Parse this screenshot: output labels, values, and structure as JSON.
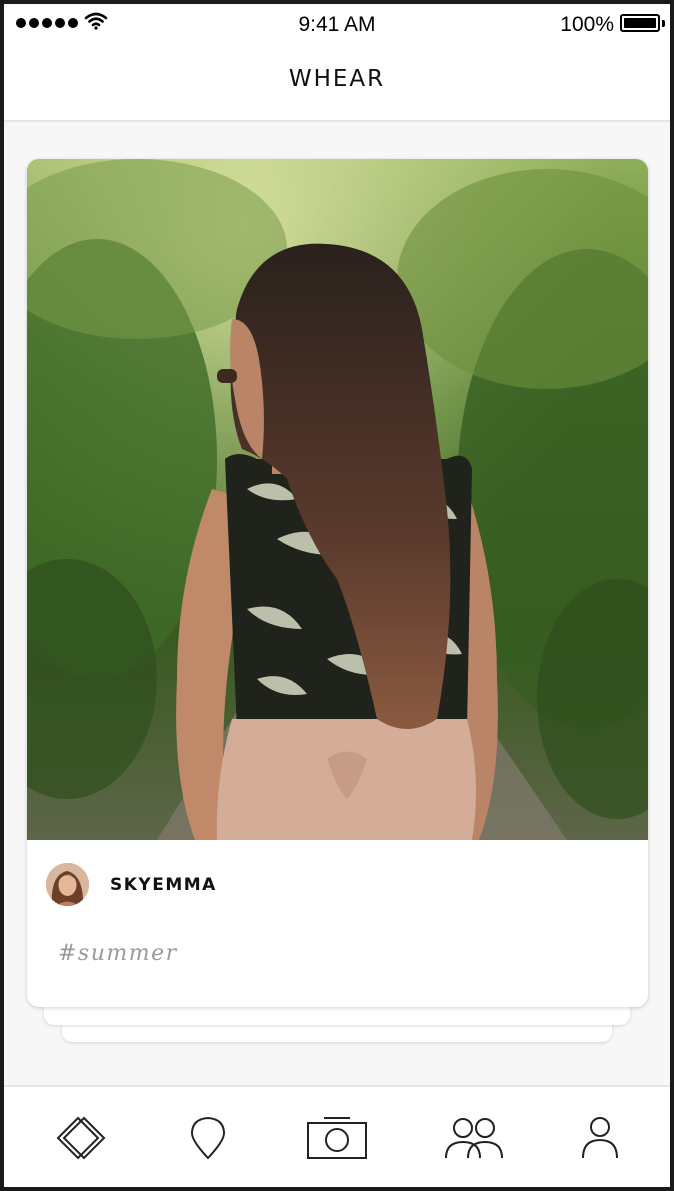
{
  "status_bar": {
    "time": "9:41 AM",
    "battery_percent": "100%",
    "signal_bars": 5,
    "icons": [
      "signal-dots-icon",
      "wifi-icon",
      "battery-icon"
    ]
  },
  "nav": {
    "title": "WHEAR"
  },
  "post": {
    "username": "SKYEMMA",
    "hashtag": "#summer",
    "photo": "woman-in-palm-print-top-in-jungle"
  },
  "tab_bar": {
    "tabs": [
      {
        "icon": "diamond-icon"
      },
      {
        "icon": "location-pin-icon"
      },
      {
        "icon": "camera-icon"
      },
      {
        "icon": "people-icon"
      },
      {
        "icon": "profile-icon"
      }
    ]
  },
  "colors": {
    "background": "#f7f7f7",
    "text": "#111111",
    "muted": "#9a9a9a",
    "divider": "#e4e4e4"
  }
}
